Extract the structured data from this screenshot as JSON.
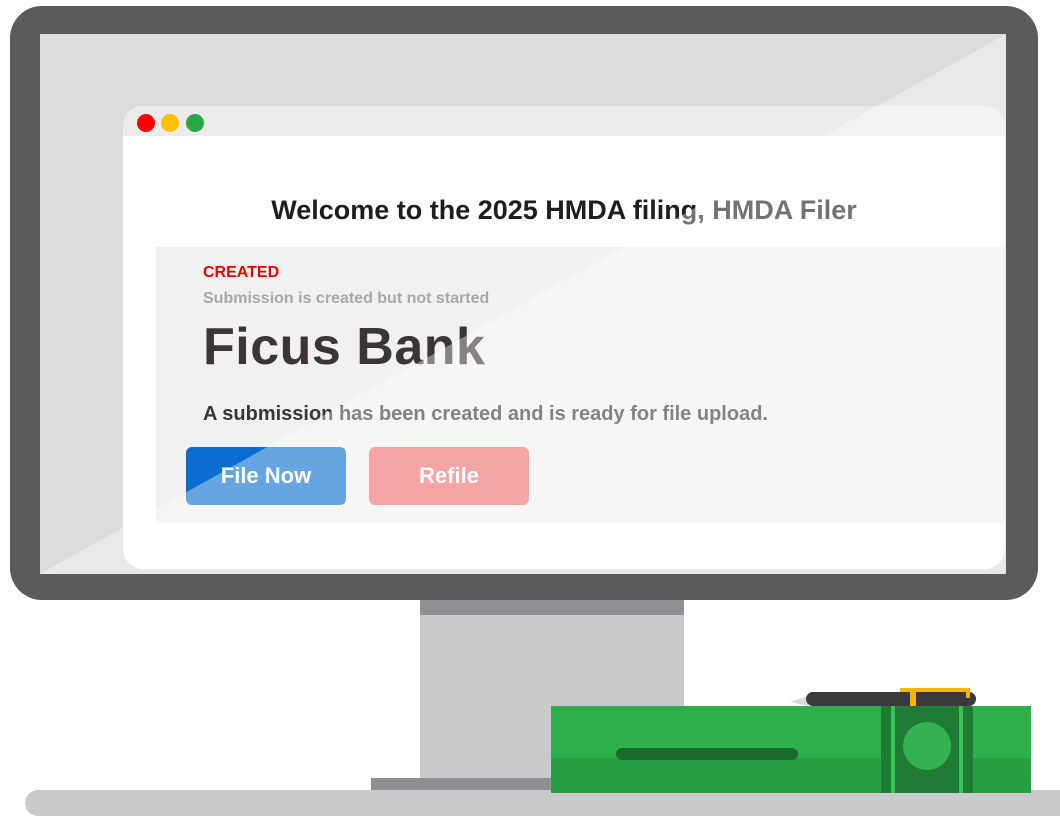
{
  "window": {
    "controls": [
      "close-dot",
      "minimize-dot",
      "maximize-dot"
    ]
  },
  "header": {
    "welcome": "Welcome to the 2025 HMDA filing, HMDA Filer"
  },
  "submission": {
    "status": "CREATED",
    "status_description": "Submission is created but not started",
    "institution": "Ficus Bank",
    "message": "A submission has been created and is ready for file upload.",
    "file_now_label": "File Now",
    "refile_label": "Refile"
  },
  "colors": {
    "bezel": "#5a5b5d",
    "screen": "#dcdcdd",
    "status": "#e00000",
    "file_now": "#0a6ed1",
    "refile": "#f26c6c",
    "money": "#2bb04a"
  },
  "icons": [
    "monitor-illustration",
    "money-stack-icon",
    "pen-icon"
  ]
}
